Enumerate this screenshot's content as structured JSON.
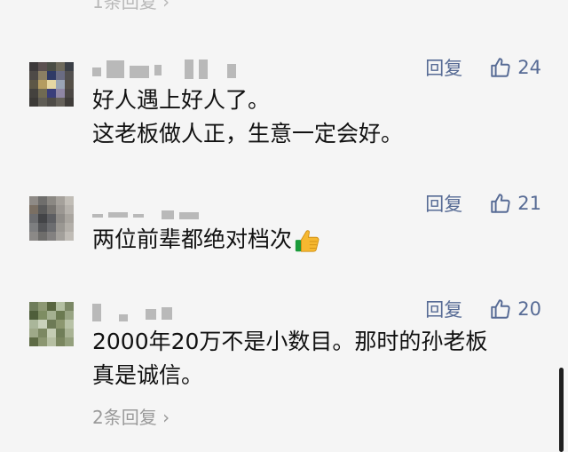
{
  "top_replies_label": "1条回复",
  "reply_label": "回复",
  "comments": [
    {
      "likes": "24",
      "lines": [
        "好人遇上好人了。",
        "这老板做人正，生意一定会好。"
      ]
    },
    {
      "likes": "21",
      "lines": [
        "两位前辈都绝对档次"
      ]
    },
    {
      "likes": "20",
      "lines": [
        "2000年20万不是小数目。那时的孙老板",
        "真是诚信。"
      ],
      "replies_label": "2条回复"
    }
  ],
  "icons": {
    "like": "thumbs-up-outline-icon",
    "emoji": "thumbs-up-emoji-icon",
    "chevron": "chevron-right-icon"
  },
  "colors": {
    "link": "#576b95",
    "muted": "#9a9a9a",
    "background": "#f5f5f5"
  }
}
